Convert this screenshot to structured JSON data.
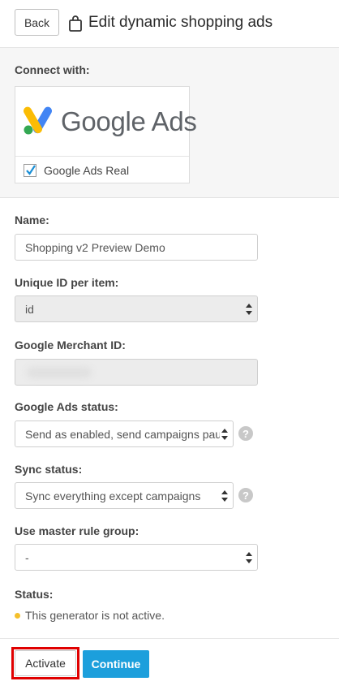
{
  "header": {
    "back_label": "Back",
    "title": "Edit dynamic shopping ads"
  },
  "connect": {
    "label": "Connect with:",
    "logo_text": "Google Ads",
    "account_label": "Google Ads Real",
    "account_checked": true
  },
  "form": {
    "name_label": "Name:",
    "name_value": "Shopping v2 Preview Demo",
    "unique_id_label": "Unique ID per item:",
    "unique_id_value": "id",
    "merchant_label": "Google Merchant ID:",
    "ads_status_label": "Google Ads status:",
    "ads_status_value": "Send as enabled, send campaigns paused",
    "sync_status_label": "Sync status:",
    "sync_status_value": "Sync everything except campaigns",
    "master_rule_label": "Use master rule group:",
    "master_rule_value": "-",
    "status_label": "Status:",
    "status_text": "This generator is not active.",
    "help_glyph": "?"
  },
  "footer": {
    "activate_label": "Activate",
    "continue_label": "Continue"
  },
  "colors": {
    "accent": "#1c9fdc",
    "status_dot": "#f5c02b",
    "highlight": "#e00000"
  }
}
